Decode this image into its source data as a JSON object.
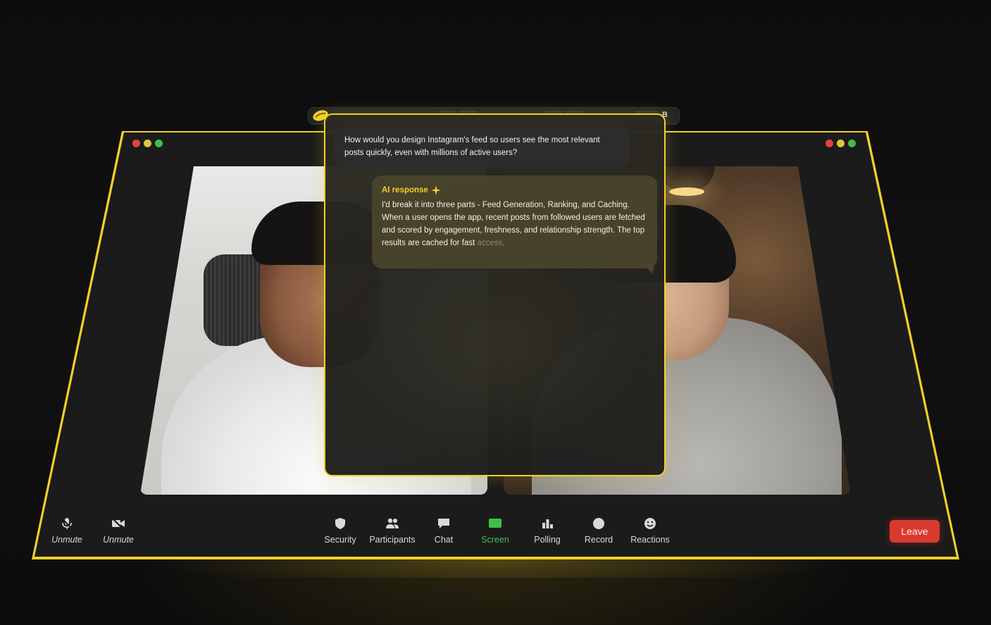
{
  "call": {
    "toolbar": {
      "left": [
        {
          "id": "mic",
          "label": "Unmute",
          "icon": "microphone-icon"
        },
        {
          "id": "video",
          "label": "Unmute",
          "icon": "video-camera-icon"
        }
      ],
      "center": [
        {
          "id": "security",
          "label": "Security",
          "icon": "shield-icon"
        },
        {
          "id": "participants",
          "label": "Participants",
          "icon": "people-icon"
        },
        {
          "id": "chat",
          "label": "Chat",
          "icon": "chat-bubble-icon"
        },
        {
          "id": "screen",
          "label": "Screen",
          "icon": "share-screen-icon"
        },
        {
          "id": "polling",
          "label": "Polling",
          "icon": "bar-chart-icon"
        },
        {
          "id": "record",
          "label": "Record",
          "icon": "record-dot-icon"
        },
        {
          "id": "reactions",
          "label": "Reactions",
          "icon": "smiley-icon"
        }
      ],
      "leave_label": "Leave"
    },
    "colors": {
      "accent": "#f2cf2a",
      "leave": "#d93a30",
      "screen_active": "#3fbf4a"
    }
  },
  "overlay": {
    "shortcut_letter": "B",
    "question": "How would you design Instagram's feed so users see the most relevant posts quickly, even with millions of active users?",
    "ai_label": "AI response",
    "answer_main": "I'd break it into three parts - Feed Generation, Ranking, and Caching. When a user opens the app, recent posts from followed users are fetched and scored by engagement, freshness, and relationship strength. The top results are cached for fast",
    "answer_fade": " access,"
  }
}
